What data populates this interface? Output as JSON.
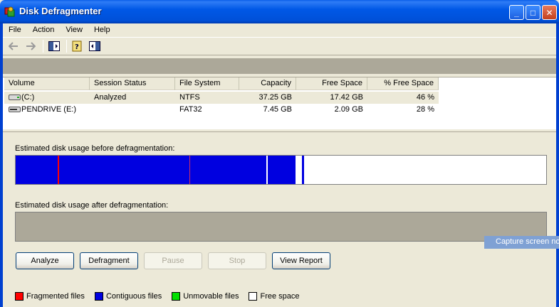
{
  "window": {
    "title": "Disk Defragmenter",
    "controls": {
      "minimize": "_",
      "maximize": "□",
      "close": "✕"
    }
  },
  "menu": [
    "File",
    "Action",
    "View",
    "Help"
  ],
  "toolbar": {
    "icons": [
      "back-arrow-icon",
      "forward-arrow-icon",
      "show-hide-console-tree-icon",
      "help-icon",
      "show-hide-action-pane-icon"
    ]
  },
  "volumes": {
    "columns": [
      "Volume",
      "Session Status",
      "File System",
      "Capacity",
      "Free Space",
      "% Free Space"
    ],
    "rows": [
      {
        "volume": "(C:)",
        "status": "Analyzed",
        "fs": "NTFS",
        "capacity": "37.25 GB",
        "free": "17.42 GB",
        "pct": "46 %"
      },
      {
        "volume": "PENDRIVE (E:)",
        "status": "",
        "fs": "FAT32",
        "capacity": "7.45 GB",
        "free": "2.09 GB",
        "pct": "28 %"
      }
    ]
  },
  "analysis": {
    "before_label": "Estimated disk usage before defragmentation:",
    "after_label": "Estimated disk usage after defragmentation:"
  },
  "buttons": {
    "analyze": "Analyze",
    "defragment": "Defragment",
    "pause": "Pause",
    "stop": "Stop",
    "view_report": "View Report"
  },
  "legend": [
    {
      "label": "Fragmented files",
      "color": "#ff0000"
    },
    {
      "label": "Contiguous files",
      "color": "#0000e0"
    },
    {
      "label": "Unmovable files",
      "color": "#00e000"
    },
    {
      "label": "Free space",
      "color": "#ffffff"
    }
  ],
  "overlay": {
    "capture_text": "Capture screen no"
  },
  "colors": {
    "titlebar": "#0058e6",
    "contiguous": "#0000e0",
    "fragmented": "#ff0000",
    "free": "#ffffff",
    "after_bar": "#aca899"
  }
}
